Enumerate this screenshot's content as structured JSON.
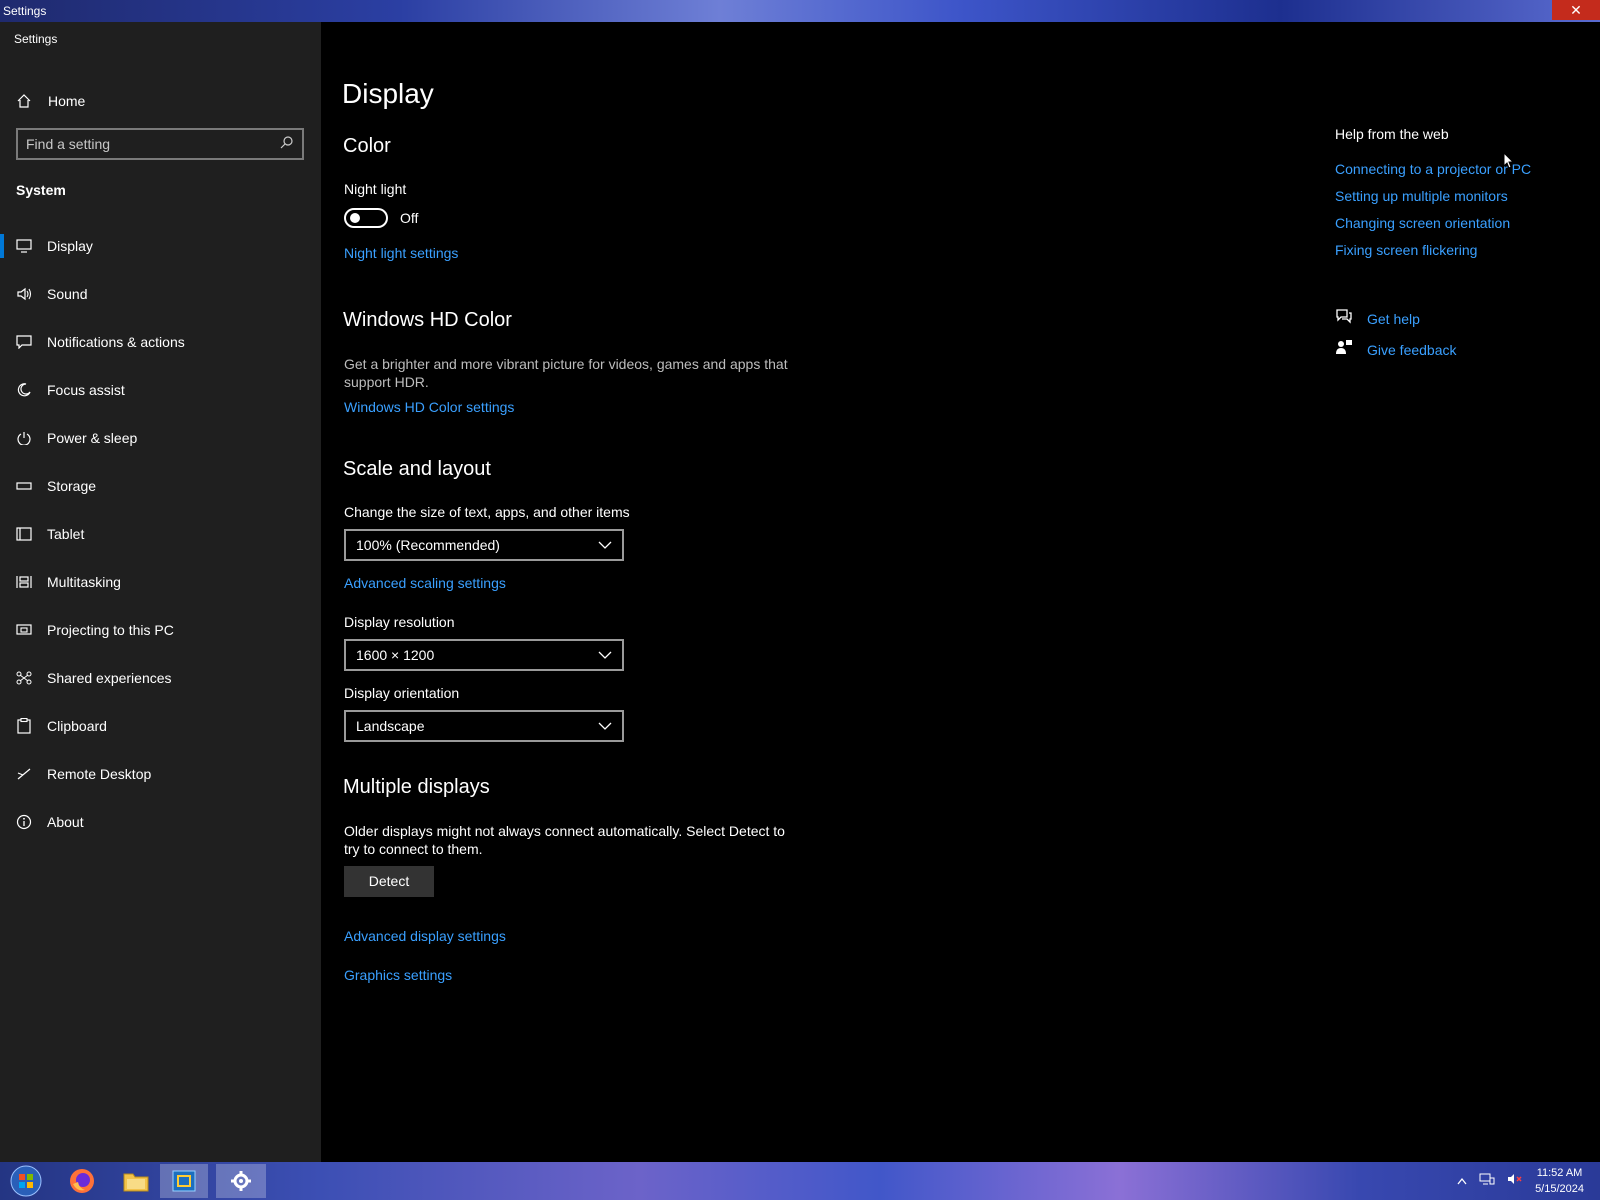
{
  "window": {
    "title": "Settings",
    "close_glyph": "✕"
  },
  "sidebar": {
    "app_title": "Settings",
    "home_label": "Home",
    "search_placeholder": "Find a setting",
    "section": "System",
    "items": [
      {
        "label": "Display",
        "icon": "monitor-icon",
        "selected": true
      },
      {
        "label": "Sound",
        "icon": "speaker-icon"
      },
      {
        "label": "Notifications & actions",
        "icon": "message-icon"
      },
      {
        "label": "Focus assist",
        "icon": "moon-icon"
      },
      {
        "label": "Power & sleep",
        "icon": "power-icon"
      },
      {
        "label": "Storage",
        "icon": "drive-icon"
      },
      {
        "label": "Tablet",
        "icon": "tablet-icon"
      },
      {
        "label": "Multitasking",
        "icon": "multitask-icon"
      },
      {
        "label": "Projecting to this PC",
        "icon": "project-icon"
      },
      {
        "label": "Shared experiences",
        "icon": "share-icon"
      },
      {
        "label": "Clipboard",
        "icon": "clipboard-icon"
      },
      {
        "label": "Remote Desktop",
        "icon": "remote-icon"
      },
      {
        "label": "About",
        "icon": "info-icon"
      }
    ]
  },
  "main": {
    "title": "Display",
    "color": {
      "heading": "Color",
      "night_light_label": "Night light",
      "night_light_state": "Off",
      "night_light_link": "Night light settings"
    },
    "hdr": {
      "heading": "Windows HD Color",
      "description": "Get a brighter and more vibrant picture for videos, games and apps that support HDR.",
      "link": "Windows HD Color settings"
    },
    "scale": {
      "heading": "Scale and layout",
      "size_label": "Change the size of text, apps, and other items",
      "size_value": "100% (Recommended)",
      "advanced_link": "Advanced scaling settings",
      "resolution_label": "Display resolution",
      "resolution_value": "1600 × 1200",
      "orientation_label": "Display orientation",
      "orientation_value": "Landscape"
    },
    "multiple": {
      "heading": "Multiple displays",
      "description": "Older displays might not always connect automatically. Select Detect to try to connect to them.",
      "detect_button": "Detect",
      "advanced_display_link": "Advanced display settings",
      "graphics_link": "Graphics settings"
    }
  },
  "help": {
    "title": "Help from the web",
    "links": [
      "Connecting to a projector or PC",
      "Setting up multiple monitors",
      "Changing screen orientation",
      "Fixing screen flickering"
    ],
    "get_help": "Get help",
    "give_feedback": "Give feedback"
  },
  "taskbar": {
    "apps": [
      "start-orb-icon",
      "firefox-icon",
      "file-explorer-icon",
      "remote-app-icon",
      "settings-gear-icon"
    ],
    "time": "11:52 AM",
    "date": "5/15/2024"
  },
  "colors": {
    "accent": "#0078d7",
    "link": "#3aa0ff",
    "sidebar_bg": "#1f1f1f",
    "main_bg": "#000000"
  }
}
